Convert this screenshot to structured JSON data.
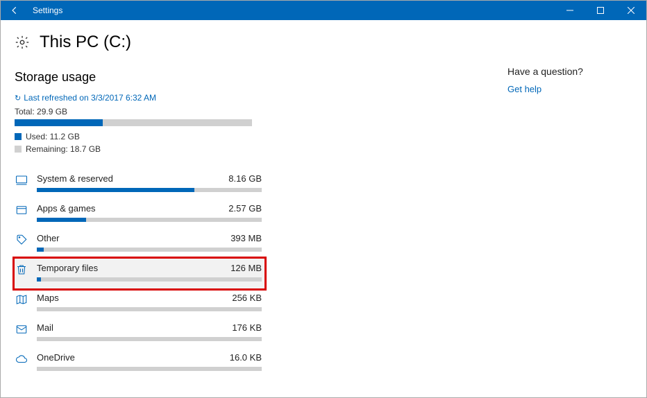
{
  "titlebar": {
    "title": "Settings"
  },
  "page": {
    "title": "This PC (C:)"
  },
  "storage": {
    "section_title": "Storage usage",
    "refresh_text": "Last refreshed on 3/3/2017 6:32 AM",
    "total_label": "Total: 29.9 GB",
    "used_label": "Used: 11.2 GB",
    "remaining_label": "Remaining: 18.7 GB",
    "used_pct": 37
  },
  "categories": [
    {
      "id": "system",
      "label": "System & reserved",
      "size": "8.16 GB",
      "pct": 70,
      "icon": "desktop",
      "highlight": false
    },
    {
      "id": "apps",
      "label": "Apps & games",
      "size": "2.57 GB",
      "pct": 22,
      "icon": "apps",
      "highlight": false
    },
    {
      "id": "other",
      "label": "Other",
      "size": "393 MB",
      "pct": 3,
      "icon": "tag",
      "highlight": false
    },
    {
      "id": "temp",
      "label": "Temporary files",
      "size": "126 MB",
      "pct": 2,
      "icon": "trash",
      "highlight": true
    },
    {
      "id": "maps",
      "label": "Maps",
      "size": "256 KB",
      "pct": 0,
      "icon": "map",
      "highlight": false
    },
    {
      "id": "mail",
      "label": "Mail",
      "size": "176 KB",
      "pct": 0,
      "icon": "mail",
      "highlight": false
    },
    {
      "id": "onedrive",
      "label": "OneDrive",
      "size": "16.0 KB",
      "pct": 0,
      "icon": "cloud",
      "highlight": false
    }
  ],
  "sidebar": {
    "question": "Have a question?",
    "help_link": "Get help"
  }
}
